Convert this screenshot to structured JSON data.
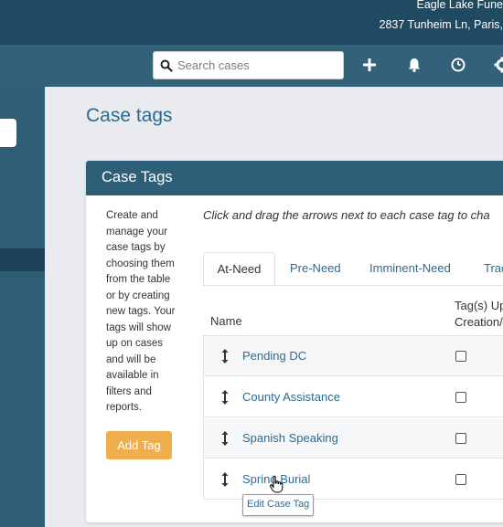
{
  "header": {
    "org_name": "Eagle Lake Fune",
    "org_address": "2837 Tunheim Ln, Paris,"
  },
  "navbar": {
    "search_placeholder": "Search cases",
    "icons": [
      "search-icon",
      "plus-icon",
      "bell-icon",
      "clock-icon",
      "gear-icon"
    ]
  },
  "page": {
    "title": "Case tags"
  },
  "panel": {
    "title": "Case Tags",
    "intro_lines": [
      "Create and",
      "manage your",
      "case tags by",
      "choosing them",
      "from the table",
      "or by creating",
      "new tags. Your",
      "tags will show",
      "up on cases",
      "and will be",
      "available in",
      "filters and",
      "reports."
    ],
    "add_button": "Add Tag",
    "instructions": "Click and drag the arrows next to each case tag to cha",
    "tabs": [
      "At-Need",
      "Pre-Need",
      "Imminent-Need",
      "Trac"
    ],
    "active_tab": "At-Need",
    "columns": {
      "name": "Name",
      "tags_line1": "Tag(s) Up",
      "tags_line2": "Creation/"
    },
    "rows": [
      {
        "name": "Pending DC",
        "checked": false
      },
      {
        "name": "County Assistance",
        "checked": false
      },
      {
        "name": "Spanish Speaking",
        "checked": false
      },
      {
        "name": "Spring Burial",
        "checked": false
      }
    ],
    "tooltip": "Edit Case Tag"
  },
  "colors": {
    "header_bg": "#1f4a62",
    "nav_bg": "#33617a",
    "sidebar_bg": "#2e5d75",
    "panel_header_bg": "#2d5f79",
    "link": "#2d6b91",
    "button": "#f0ad4e"
  }
}
